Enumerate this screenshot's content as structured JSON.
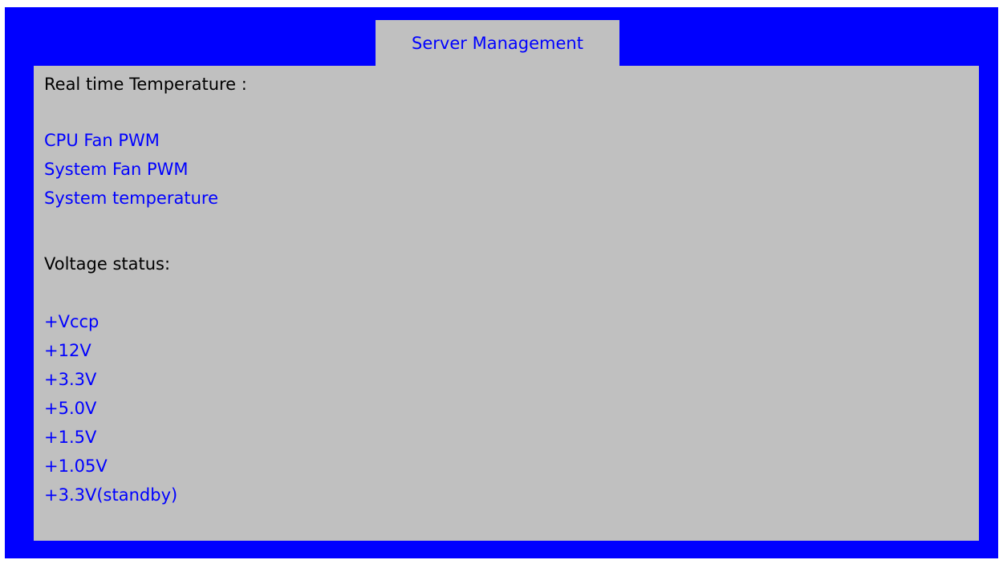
{
  "tab": {
    "title": "Server Management"
  },
  "temperature": {
    "heading": "Real time Temperature :",
    "items": [
      "CPU Fan PWM",
      "System Fan PWM",
      "System temperature"
    ]
  },
  "voltage": {
    "heading": "Voltage status:",
    "items": [
      "+Vccp",
      "+12V",
      "+3.3V",
      "+5.0V",
      "+1.5V",
      "+1.05V",
      "+3.3V(standby)"
    ]
  },
  "colors": {
    "frame": "#0000ff",
    "panel": "#c0c0c0",
    "item_text": "#0000ff",
    "heading_text": "#000000"
  }
}
